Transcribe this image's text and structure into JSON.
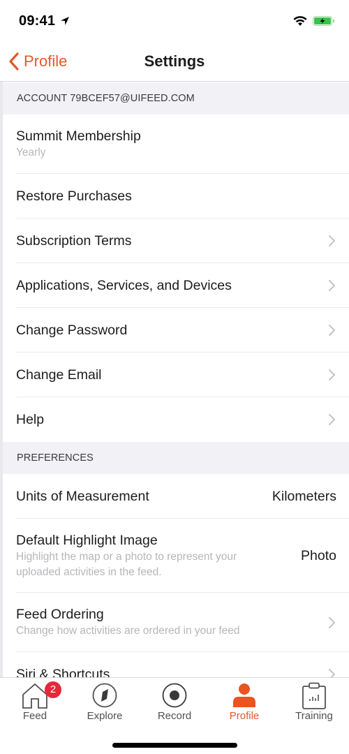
{
  "status_bar": {
    "time": "09:41",
    "location_icon": "location-arrow-icon",
    "wifi_icon": "wifi-icon",
    "battery_icon": "battery-charging-icon"
  },
  "nav": {
    "back_label": "Profile",
    "back_icon": "chevron-left-icon",
    "title": "Settings",
    "accent_color": "#e4582b"
  },
  "sections": [
    {
      "header": "ACCOUNT 79BCEF57@UIFEED.COM",
      "rows": [
        {
          "title": "Summit Membership",
          "subtitle": "Yearly",
          "chevron": false
        },
        {
          "title": "Restore Purchases",
          "chevron": false
        },
        {
          "title": "Subscription Terms",
          "chevron": true
        },
        {
          "title": "Applications, Services, and Devices",
          "chevron": true
        },
        {
          "title": "Change Password",
          "chevron": true
        },
        {
          "title": "Change Email",
          "chevron": true
        },
        {
          "title": "Help",
          "chevron": true
        }
      ]
    },
    {
      "header": "PREFERENCES",
      "rows": [
        {
          "title": "Units of Measurement",
          "value": "Kilometers",
          "chevron": false
        },
        {
          "title": "Default Highlight Image",
          "subtitle": "Highlight the map or a photo to represent your uploaded activities in the feed.",
          "value": "Photo",
          "chevron": false
        },
        {
          "title": "Feed Ordering",
          "subtitle": "Change how activities are ordered in your feed",
          "chevron": true
        },
        {
          "title": "Siri & Shortcuts",
          "chevron": true
        }
      ]
    }
  ],
  "tab_bar": {
    "tabs": [
      {
        "label": "Feed",
        "icon": "home-icon",
        "badge": "2",
        "active": false
      },
      {
        "label": "Explore",
        "icon": "compass-icon",
        "active": false
      },
      {
        "label": "Record",
        "icon": "record-icon",
        "active": false
      },
      {
        "label": "Profile",
        "icon": "person-icon",
        "active": true
      },
      {
        "label": "Training",
        "icon": "clipboard-chart-icon",
        "active": false
      }
    ],
    "active_color": "#e4582b",
    "badge_color": "#e8273b"
  }
}
